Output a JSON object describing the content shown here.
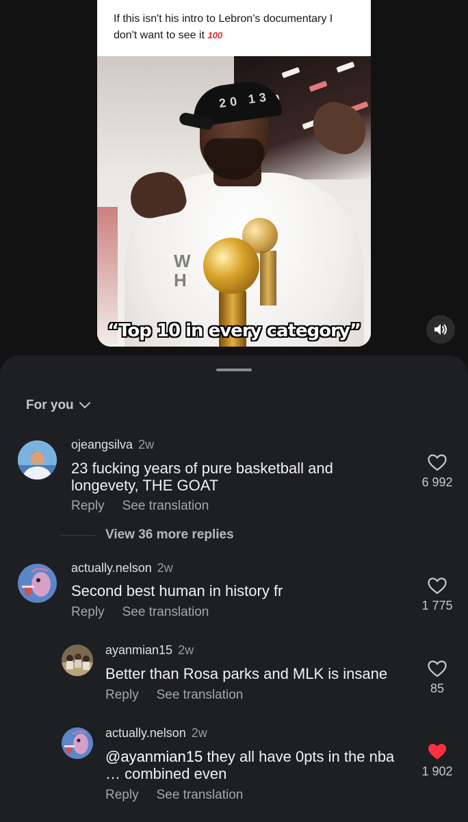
{
  "video": {
    "caption": "If this isn't his intro to Lebron’s documentary I don't want to see it",
    "caption_emoji": "100",
    "overlay_text": "“Top 10 in every category”",
    "volume_icon": "volume-icon"
  },
  "comments_sheet": {
    "filter_label": "For you",
    "filter_icon": "chevron-down-icon",
    "comments": [
      {
        "username": "ojeangsilva",
        "age": "2w",
        "text": "23 fucking years of pure basketball and longevety, THE GOAT",
        "reply_label": "Reply",
        "translate_label": "See translation",
        "likes": "6 992",
        "liked": false
      },
      {
        "username": "actually.nelson",
        "age": "2w",
        "text": "Second best human in history fr",
        "reply_label": "Reply",
        "translate_label": "See translation",
        "likes": "1 775",
        "liked": false
      }
    ],
    "view_more_replies": "View 36 more replies",
    "replies": [
      {
        "username": "ayanmian15",
        "age": "2w",
        "text": "Better than Rosa parks and MLK is insane",
        "reply_label": "Reply",
        "translate_label": "See translation",
        "likes": "85",
        "liked": false
      },
      {
        "username": "actually.nelson",
        "age": "2w",
        "mention": "@ayanmian15",
        "text": " they all have 0pts in the nba … combined even",
        "reply_label": "Reply",
        "translate_label": "See translation",
        "likes": "1 902",
        "liked": true
      }
    ]
  },
  "colors": {
    "background": "#121212",
    "sheet": "#1d1f23",
    "liked_heart": "#ff3040"
  }
}
